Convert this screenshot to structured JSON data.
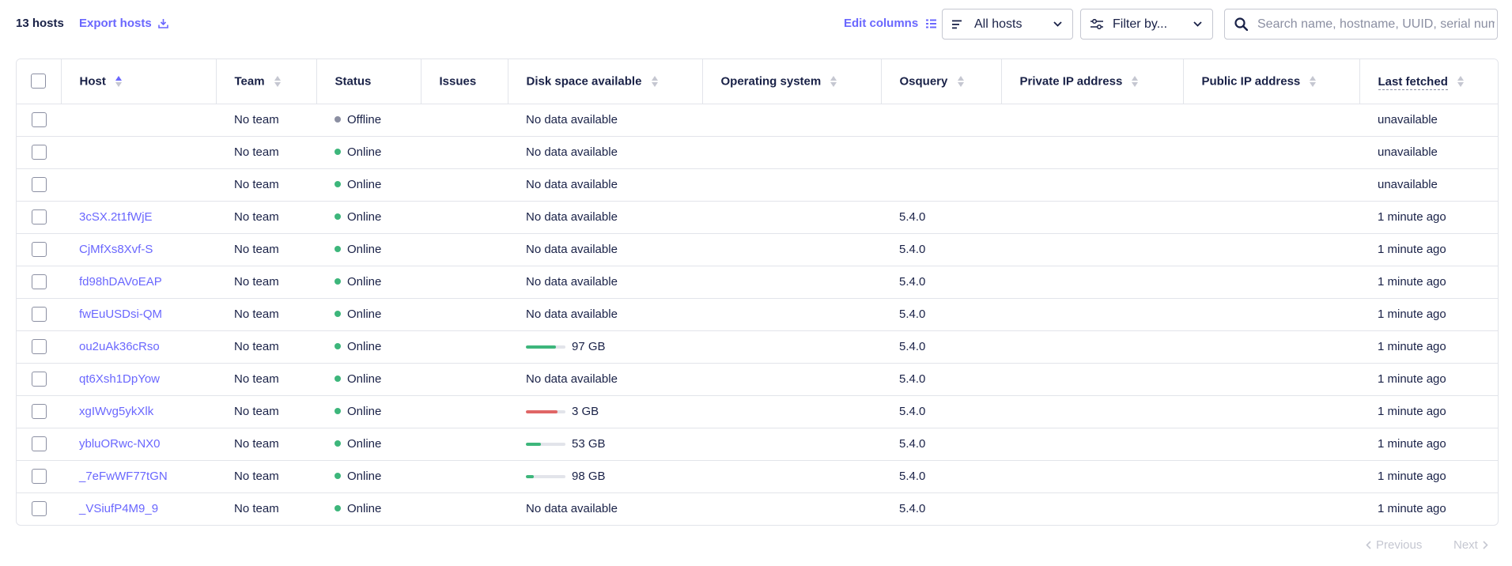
{
  "toolbar": {
    "host_count": "13 hosts",
    "export_label": "Export hosts",
    "edit_columns_label": "Edit columns",
    "all_hosts_label": "All hosts",
    "filter_label": "Filter by...",
    "search_placeholder": "Search name, hostname, UUID, serial number, or IP address"
  },
  "colors": {
    "accent": "#6a67fe",
    "online": "#3db67b",
    "offline": "#8b8fa2",
    "disk_ok": "#3db67b",
    "disk_low": "#e06666"
  },
  "icons": {
    "export": "download-icon",
    "edit_columns": "columns-icon",
    "all_hosts": "filter-lines-icon",
    "filter_by": "sliders-icon",
    "search": "search-icon",
    "chevron": "chevron-down-icon"
  },
  "table": {
    "columns": [
      {
        "label": "Host",
        "sortable": true,
        "sort": "asc"
      },
      {
        "label": "Team",
        "sortable": true
      },
      {
        "label": "Status",
        "sortable": false
      },
      {
        "label": "Issues",
        "sortable": false
      },
      {
        "label": "Disk space available",
        "sortable": true
      },
      {
        "label": "Operating system",
        "sortable": true
      },
      {
        "label": "Osquery",
        "sortable": true
      },
      {
        "label": "Private IP address",
        "sortable": true
      },
      {
        "label": "Public IP address",
        "sortable": true
      },
      {
        "label": "Last fetched",
        "sortable": true
      }
    ],
    "rows": [
      {
        "host": "",
        "team": "No team",
        "status": "Offline",
        "issues": "",
        "disk_text": "No data available",
        "disk_fraction": null,
        "disk_level": "",
        "os": "",
        "osquery": "",
        "private_ip": "",
        "public_ip": "",
        "last_fetched": "unavailable"
      },
      {
        "host": "",
        "team": "No team",
        "status": "Online",
        "issues": "",
        "disk_text": "No data available",
        "disk_fraction": null,
        "disk_level": "",
        "os": "",
        "osquery": "",
        "private_ip": "",
        "public_ip": "",
        "last_fetched": "unavailable"
      },
      {
        "host": "",
        "team": "No team",
        "status": "Online",
        "issues": "",
        "disk_text": "No data available",
        "disk_fraction": null,
        "disk_level": "",
        "os": "",
        "osquery": "",
        "private_ip": "",
        "public_ip": "",
        "last_fetched": "unavailable"
      },
      {
        "host": "3cSX.2t1fWjE",
        "team": "No team",
        "status": "Online",
        "issues": "",
        "disk_text": "No data available",
        "disk_fraction": null,
        "disk_level": "",
        "os": "",
        "osquery": "5.4.0",
        "private_ip": "",
        "public_ip": "",
        "last_fetched": "1 minute ago"
      },
      {
        "host": "CjMfXs8Xvf-S",
        "team": "No team",
        "status": "Online",
        "issues": "",
        "disk_text": "No data available",
        "disk_fraction": null,
        "disk_level": "",
        "os": "",
        "osquery": "5.4.0",
        "private_ip": "",
        "public_ip": "",
        "last_fetched": "1 minute ago"
      },
      {
        "host": "fd98hDAVoEAP",
        "team": "No team",
        "status": "Online",
        "issues": "",
        "disk_text": "No data available",
        "disk_fraction": null,
        "disk_level": "",
        "os": "",
        "osquery": "5.4.0",
        "private_ip": "",
        "public_ip": "",
        "last_fetched": "1 minute ago"
      },
      {
        "host": "fwEuUSDsi-QM",
        "team": "No team",
        "status": "Online",
        "issues": "",
        "disk_text": "No data available",
        "disk_fraction": null,
        "disk_level": "",
        "os": "",
        "osquery": "5.4.0",
        "private_ip": "",
        "public_ip": "",
        "last_fetched": "1 minute ago"
      },
      {
        "host": "ou2uAk36cRso",
        "team": "No team",
        "status": "Online",
        "issues": "",
        "disk_text": "97 GB",
        "disk_fraction": 0.75,
        "disk_level": "ok",
        "os": "",
        "osquery": "5.4.0",
        "private_ip": "",
        "public_ip": "",
        "last_fetched": "1 minute ago"
      },
      {
        "host": "qt6Xsh1DpYow",
        "team": "No team",
        "status": "Online",
        "issues": "",
        "disk_text": "No data available",
        "disk_fraction": null,
        "disk_level": "",
        "os": "",
        "osquery": "5.4.0",
        "private_ip": "",
        "public_ip": "",
        "last_fetched": "1 minute ago"
      },
      {
        "host": "xgIWvg5ykXlk",
        "team": "No team",
        "status": "Online",
        "issues": "",
        "disk_text": "3 GB",
        "disk_fraction": 0.8,
        "disk_level": "low",
        "os": "",
        "osquery": "5.4.0",
        "private_ip": "",
        "public_ip": "",
        "last_fetched": "1 minute ago"
      },
      {
        "host": "ybluORwc-NX0",
        "team": "No team",
        "status": "Online",
        "issues": "",
        "disk_text": "53 GB",
        "disk_fraction": 0.38,
        "disk_level": "ok",
        "os": "",
        "osquery": "5.4.0",
        "private_ip": "",
        "public_ip": "",
        "last_fetched": "1 minute ago"
      },
      {
        "host": "_7eFwWF77tGN",
        "team": "No team",
        "status": "Online",
        "issues": "",
        "disk_text": "98 GB",
        "disk_fraction": 0.2,
        "disk_level": "ok",
        "os": "",
        "osquery": "5.4.0",
        "private_ip": "",
        "public_ip": "",
        "last_fetched": "1 minute ago"
      },
      {
        "host": "_VSiufP4M9_9",
        "team": "No team",
        "status": "Online",
        "issues": "",
        "disk_text": "No data available",
        "disk_fraction": null,
        "disk_level": "",
        "os": "",
        "osquery": "5.4.0",
        "private_ip": "",
        "public_ip": "",
        "last_fetched": "1 minute ago"
      }
    ]
  },
  "pagination": {
    "previous_label": "Previous",
    "next_label": "Next"
  }
}
